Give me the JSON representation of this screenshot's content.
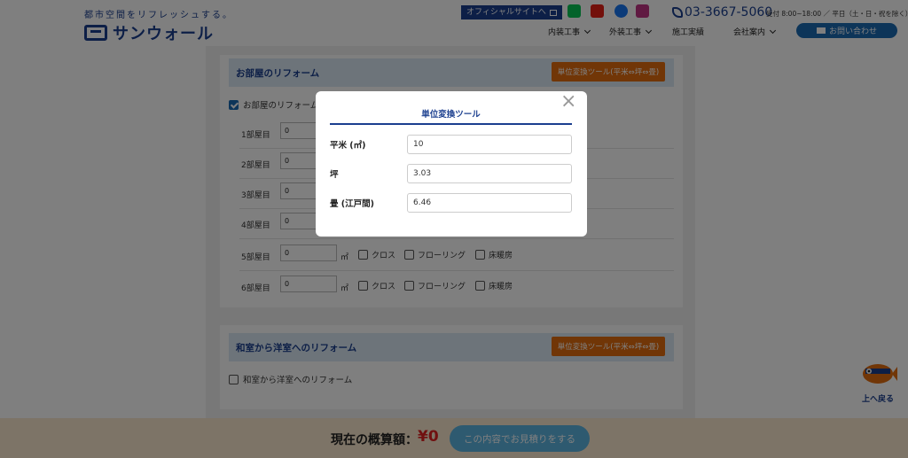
{
  "header": {
    "tagline": "都市空間をリフレッシュする。",
    "logo_text": "サンウォール",
    "official_site": "オフィシャルサイトへ",
    "phone": "03-3667-5060",
    "hours": "受付 8:00~18:00 ／ 平日（土・日・祝を除く）",
    "nav": [
      "内装工事",
      "外装工事",
      "施工実績",
      "会社案内"
    ],
    "contact": "お問い合わせ",
    "social_colors": {
      "line": "#06c755",
      "youtube": "#e62117",
      "facebook": "#1877f2",
      "instagram": "#c13584"
    }
  },
  "section1": {
    "title": "お部屋のリフォーム",
    "unit_tool": "単位変換ツール(平米⇔坪⇔畳)",
    "checkbox_label": "お部屋のリフォーム",
    "rooms": [
      {
        "label": "1部屋目",
        "value": "0"
      },
      {
        "label": "2部屋目",
        "value": "0"
      },
      {
        "label": "3部屋目",
        "value": "0"
      },
      {
        "label": "4部屋目",
        "value": "0"
      },
      {
        "label": "5部屋目",
        "value": "0",
        "unit": "㎡",
        "options": [
          "クロス",
          "フローリング",
          "床暖房"
        ]
      },
      {
        "label": "6部屋目",
        "value": "0",
        "unit": "㎡",
        "options": [
          "クロス",
          "フローリング",
          "床暖房"
        ]
      }
    ]
  },
  "section2": {
    "title": "和室から洋室へのリフォーム",
    "unit_tool": "単位変換ツール(平米⇔坪⇔畳)",
    "checkbox_label": "和室から洋室へのリフォーム"
  },
  "side": {
    "back_to_top": "上へ戻る"
  },
  "bottom": {
    "estimate_label": "現在の概算額：",
    "estimate_amount": "¥0",
    "quote_button": "この内容でお見積りをする"
  },
  "modal": {
    "close": "×",
    "title": "単位変換ツール",
    "fields": [
      {
        "label": "平米 (㎡)",
        "value": "10"
      },
      {
        "label": "坪",
        "value": "3.03"
      },
      {
        "label": "畳 (江戸間)",
        "value": "6.46"
      }
    ]
  },
  "colors": {
    "brand": "#1b3f8f",
    "accent": "#e36d0f",
    "price": "#e02020"
  }
}
